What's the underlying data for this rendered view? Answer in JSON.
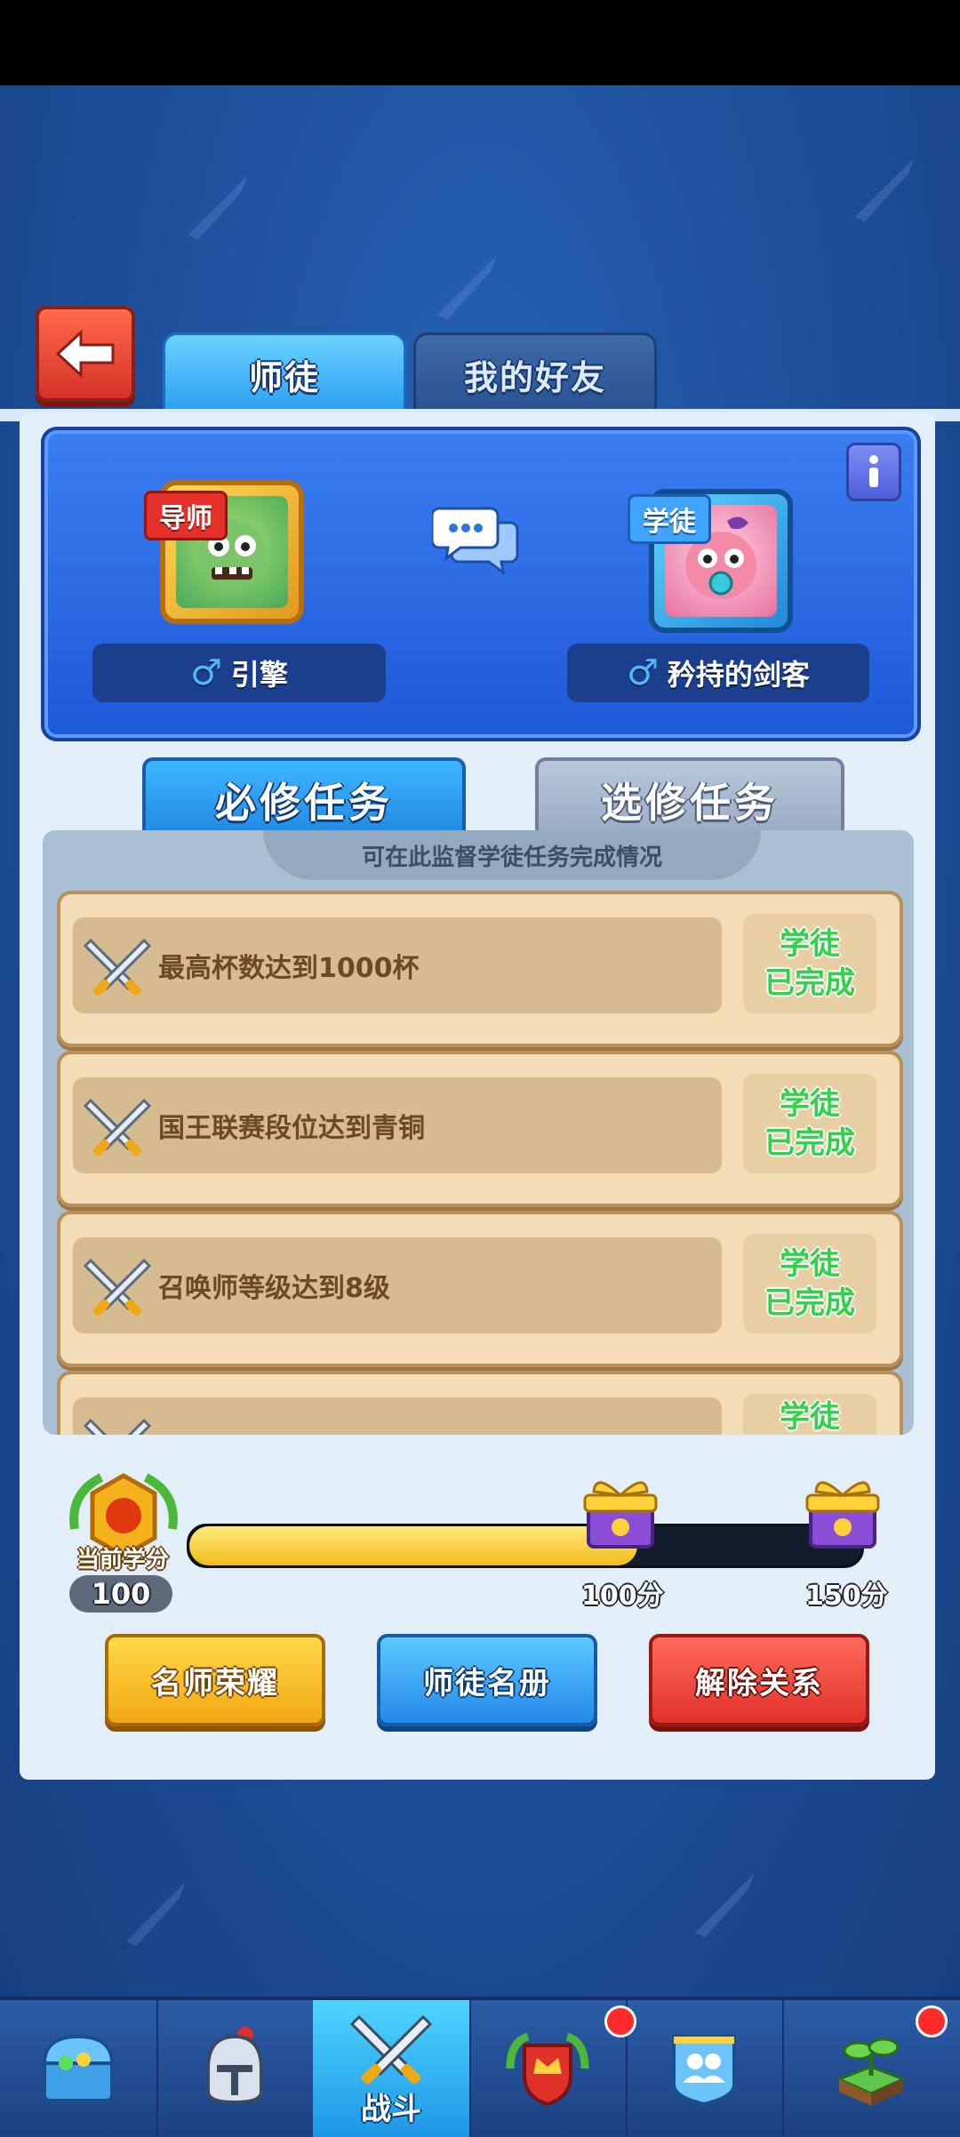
{
  "colors": {
    "accent": "#2a9ff0",
    "complete_green": "#32d14a",
    "bar_fill": "#f2bd1c",
    "danger": "#e0322a"
  },
  "header": {
    "back_icon": "back-arrow-icon"
  },
  "tabs": [
    {
      "label": "师徒",
      "active": true
    },
    {
      "label": "我的好友",
      "active": false
    }
  ],
  "mentor_card": {
    "mentor": {
      "role": "导师",
      "name": "引擎",
      "gender_icon": "♂"
    },
    "student": {
      "role": "学徒",
      "name": "矜持的剑客",
      "gender_icon": "♂"
    },
    "chat_icon": "chat-bubble-icon",
    "info_icon": "info-icon"
  },
  "task_tabs": [
    {
      "label": "必修任务",
      "active": true
    },
    {
      "label": "选修任务",
      "active": false
    }
  ],
  "hint": "可在此监督学徒任务完成情况",
  "tasks": [
    {
      "text": "最高杯数达到1000杯",
      "status_line1": "学徒",
      "status_line2": "已完成"
    },
    {
      "text": "国王联赛段位达到青铜",
      "status_line1": "学徒",
      "status_line2": "已完成"
    },
    {
      "text": "召唤师等级达到8级",
      "status_line1": "学徒",
      "status_line2": "已完成"
    },
    {
      "text": "",
      "status_line1": "学徒",
      "status_line2": ""
    }
  ],
  "progress": {
    "label": "当前学分",
    "current": "100",
    "fraction": 0.667,
    "milestones": [
      {
        "label": "100分"
      },
      {
        "label": "150分"
      }
    ]
  },
  "buttons": {
    "famous": "名师荣耀",
    "roster": "师徒名册",
    "dissolve": "解除关系"
  },
  "nav": [
    {
      "icon": "treasure-chest-icon",
      "label": "",
      "badge": false
    },
    {
      "icon": "knight-helmet-icon",
      "label": "",
      "badge": false
    },
    {
      "icon": "crossed-swords-icon",
      "label": "战斗",
      "badge": false,
      "active": true
    },
    {
      "icon": "crown-shield-icon",
      "label": "",
      "badge": true
    },
    {
      "icon": "social-icon",
      "label": "",
      "badge": false
    },
    {
      "icon": "sprout-icon",
      "label": "",
      "badge": true
    }
  ]
}
